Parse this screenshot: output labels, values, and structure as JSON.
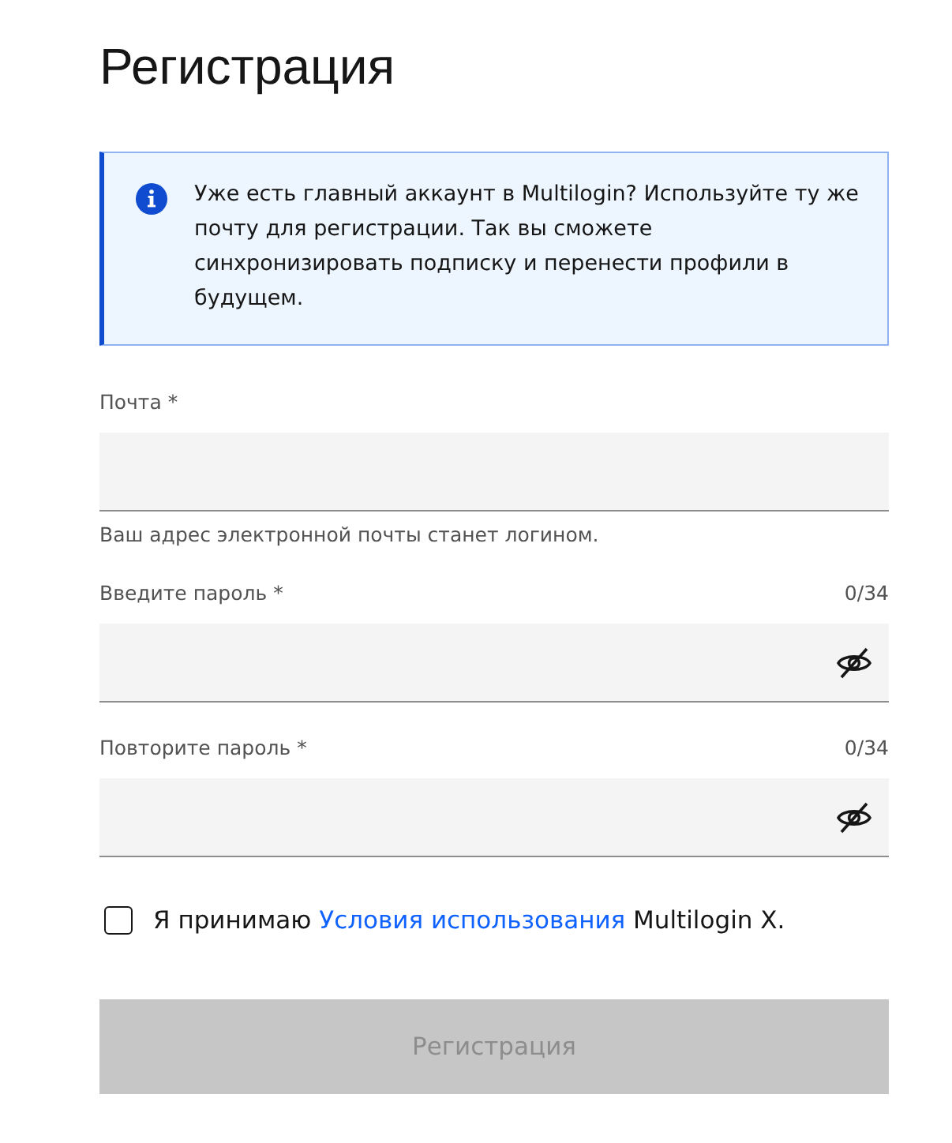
{
  "title": "Регистрация",
  "notice": {
    "text": "Уже есть главный аккаунт в Multilogin? Используйте ту же почту для регистрации. Так вы сможете синхронизировать подписку и перенести профили в будущем."
  },
  "fields": [
    {
      "kind": "email",
      "label": "Почта *",
      "helper": "Ваш адрес электронной почты станет логином."
    },
    {
      "kind": "password",
      "label": "Введите пароль *",
      "counter": "0/34"
    },
    {
      "kind": "password",
      "label": "Повторите пароль *",
      "counter": "0/34"
    }
  ],
  "terms": {
    "checked": false,
    "before": "Я принимаю",
    "link": "Условия использования",
    "after": "Multilogin X."
  },
  "submit": {
    "label": "Регистрация",
    "disabled": true
  }
}
